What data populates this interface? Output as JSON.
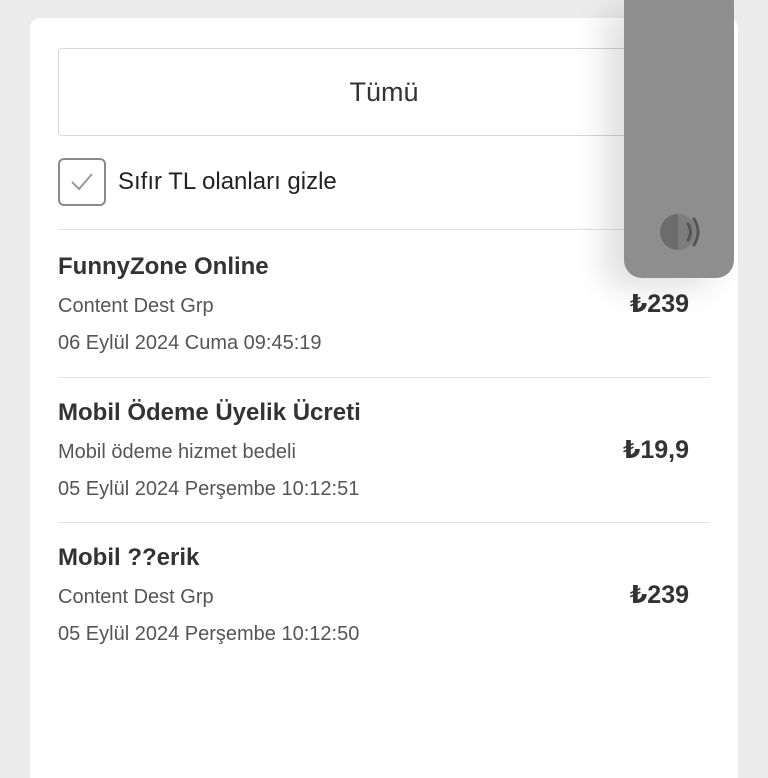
{
  "filter": {
    "selected": "Tümü"
  },
  "hide_zero": {
    "label": "Sıfır TL olanları gizle",
    "checked": true
  },
  "transactions": [
    {
      "title": "FunnyZone Online",
      "description": "Content Dest Grp",
      "date": "06 Eylül 2024 Cuma 09:45:19",
      "amount": "₺239"
    },
    {
      "title": "Mobil Ödeme Üyelik Ücreti",
      "description": "Mobil ödeme hizmet bedeli",
      "date": "05 Eylül 2024 Perşembe 10:12:51",
      "amount": "₺19,9"
    },
    {
      "title": "Mobil ??erik",
      "description": "Content Dest Grp",
      "date": "05 Eylül 2024 Perşembe 10:12:50",
      "amount": "₺239"
    }
  ],
  "side_panel": {
    "icon": "speaker-icon",
    "color": "#8e8e8e"
  }
}
